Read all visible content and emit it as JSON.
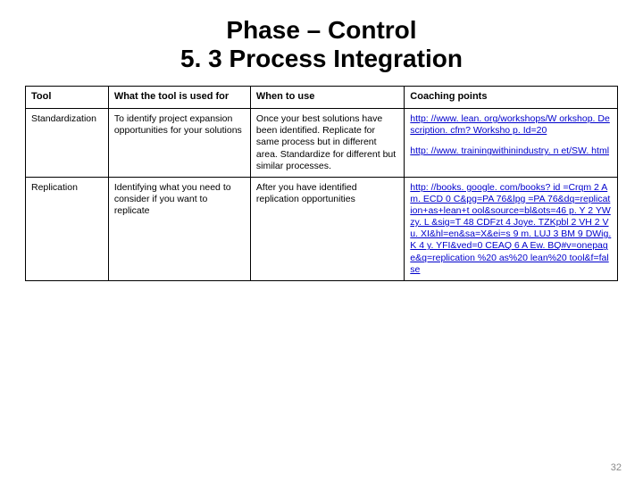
{
  "title_line1": "Phase – Control",
  "title_line2": "5. 3 Process Integration",
  "headers": {
    "tool": "Tool",
    "used_for": "What the tool is used for",
    "when": "When to use",
    "coaching": "Coaching points"
  },
  "rows": [
    {
      "tool": "Standardization",
      "used_for": "To identify project expansion opportunities for your solutions",
      "when": "Once your best solutions have been identified.\nReplicate for same process but in different area.\nStandardize for different but similar processes.",
      "links": [
        "http: //www. lean. org/workshops/W orkshop. Description. cfm? Worksho p. Id=20",
        "http: //www. trainingwithinindustry. n et/SW. html"
      ]
    },
    {
      "tool": "Replication",
      "used_for": "Identifying what you need to consider if you want to replicate",
      "when": "After you have identified replication opportunities",
      "links": [
        "http: //books. google. com/books? id =Crqm 2 Am. ECD 0 C&pg=PA 76&lpg =PA 76&dq=replication+as+lean+t ool&source=bl&ots=46 p. Y 2 YWzy. L &sig=T 48 CDFzt 4 Joye. TZKpbl 2 VH 2 Vu. XI&hl=en&sa=X&ei=s 9 m. LUJ 3 BM 9 DWig. K 4 y. YFI&ved=0 CEAQ 6 A Ew. BQ#v=onepage&q=replication %20 as%20 lean%20 tool&f=false"
      ]
    }
  ],
  "page_number": "32"
}
